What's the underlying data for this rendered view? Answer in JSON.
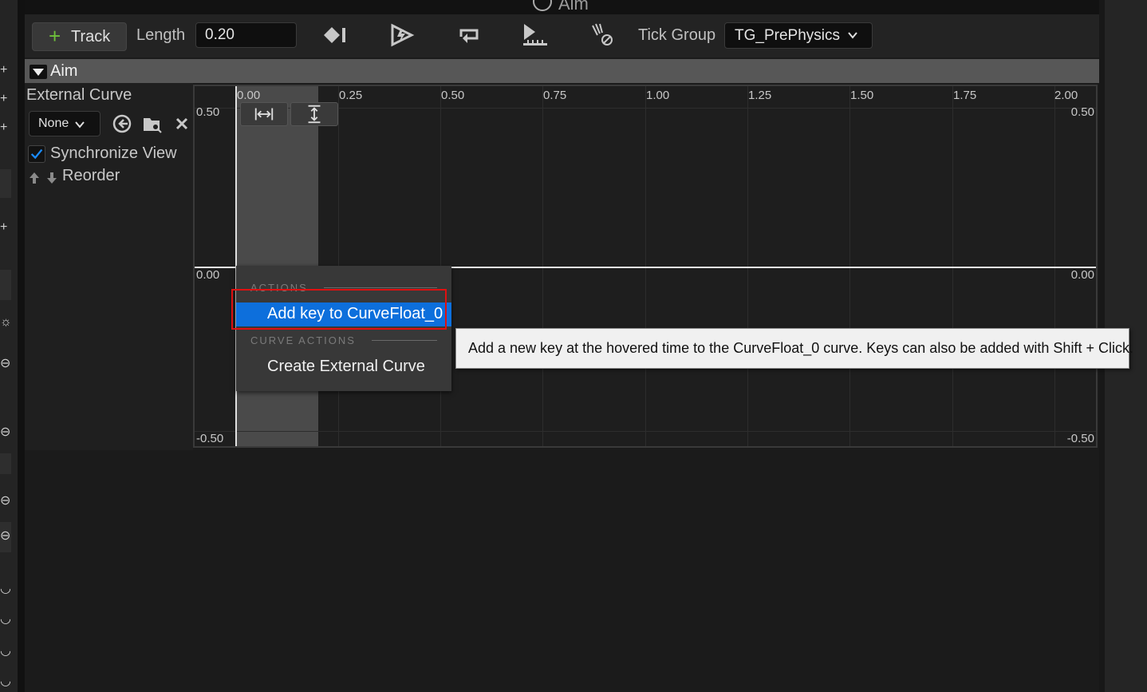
{
  "window": {
    "tab_title": "Aim"
  },
  "toolbar": {
    "track_button": "Track",
    "length_label": "Length",
    "length_value": "0.20",
    "tick_group_label": "Tick Group",
    "tick_group_value": "TG_PrePhysics",
    "icons": [
      "add-keyframe-icon",
      "autoplay-icon",
      "loop-icon",
      "use-last-keyframe-icon",
      "ignore-time-dilation-icon"
    ]
  },
  "track": {
    "name": "Aim",
    "external_curve_label": "External Curve",
    "external_curve_value": "None",
    "synchronize_view_label": "Synchronize View",
    "synchronize_view_checked": true,
    "reorder_label": "Reorder"
  },
  "graph": {
    "x_ticks": [
      "0.00",
      "0.25",
      "0.50",
      "0.75",
      "1.00",
      "1.25",
      "1.50",
      "1.75",
      "2.00"
    ],
    "y_top": "0.50",
    "y_mid": "0.00",
    "y_bottom": "-0.50"
  },
  "context_menu": {
    "section_actions": "ACTIONS",
    "add_key": "Add key to CurveFloat_0",
    "section_curve_actions": "CURVE ACTIONS",
    "create_external_curve": "Create External Curve"
  },
  "tooltip": {
    "text": "Add a new key at the hovered time to the CurveFloat_0 curve.  Keys can also be added with Shift + Click."
  },
  "colors": {
    "accent_highlight": "#0d6fdc",
    "annotation_box": "#e01010",
    "add_green": "#6ec03a"
  }
}
